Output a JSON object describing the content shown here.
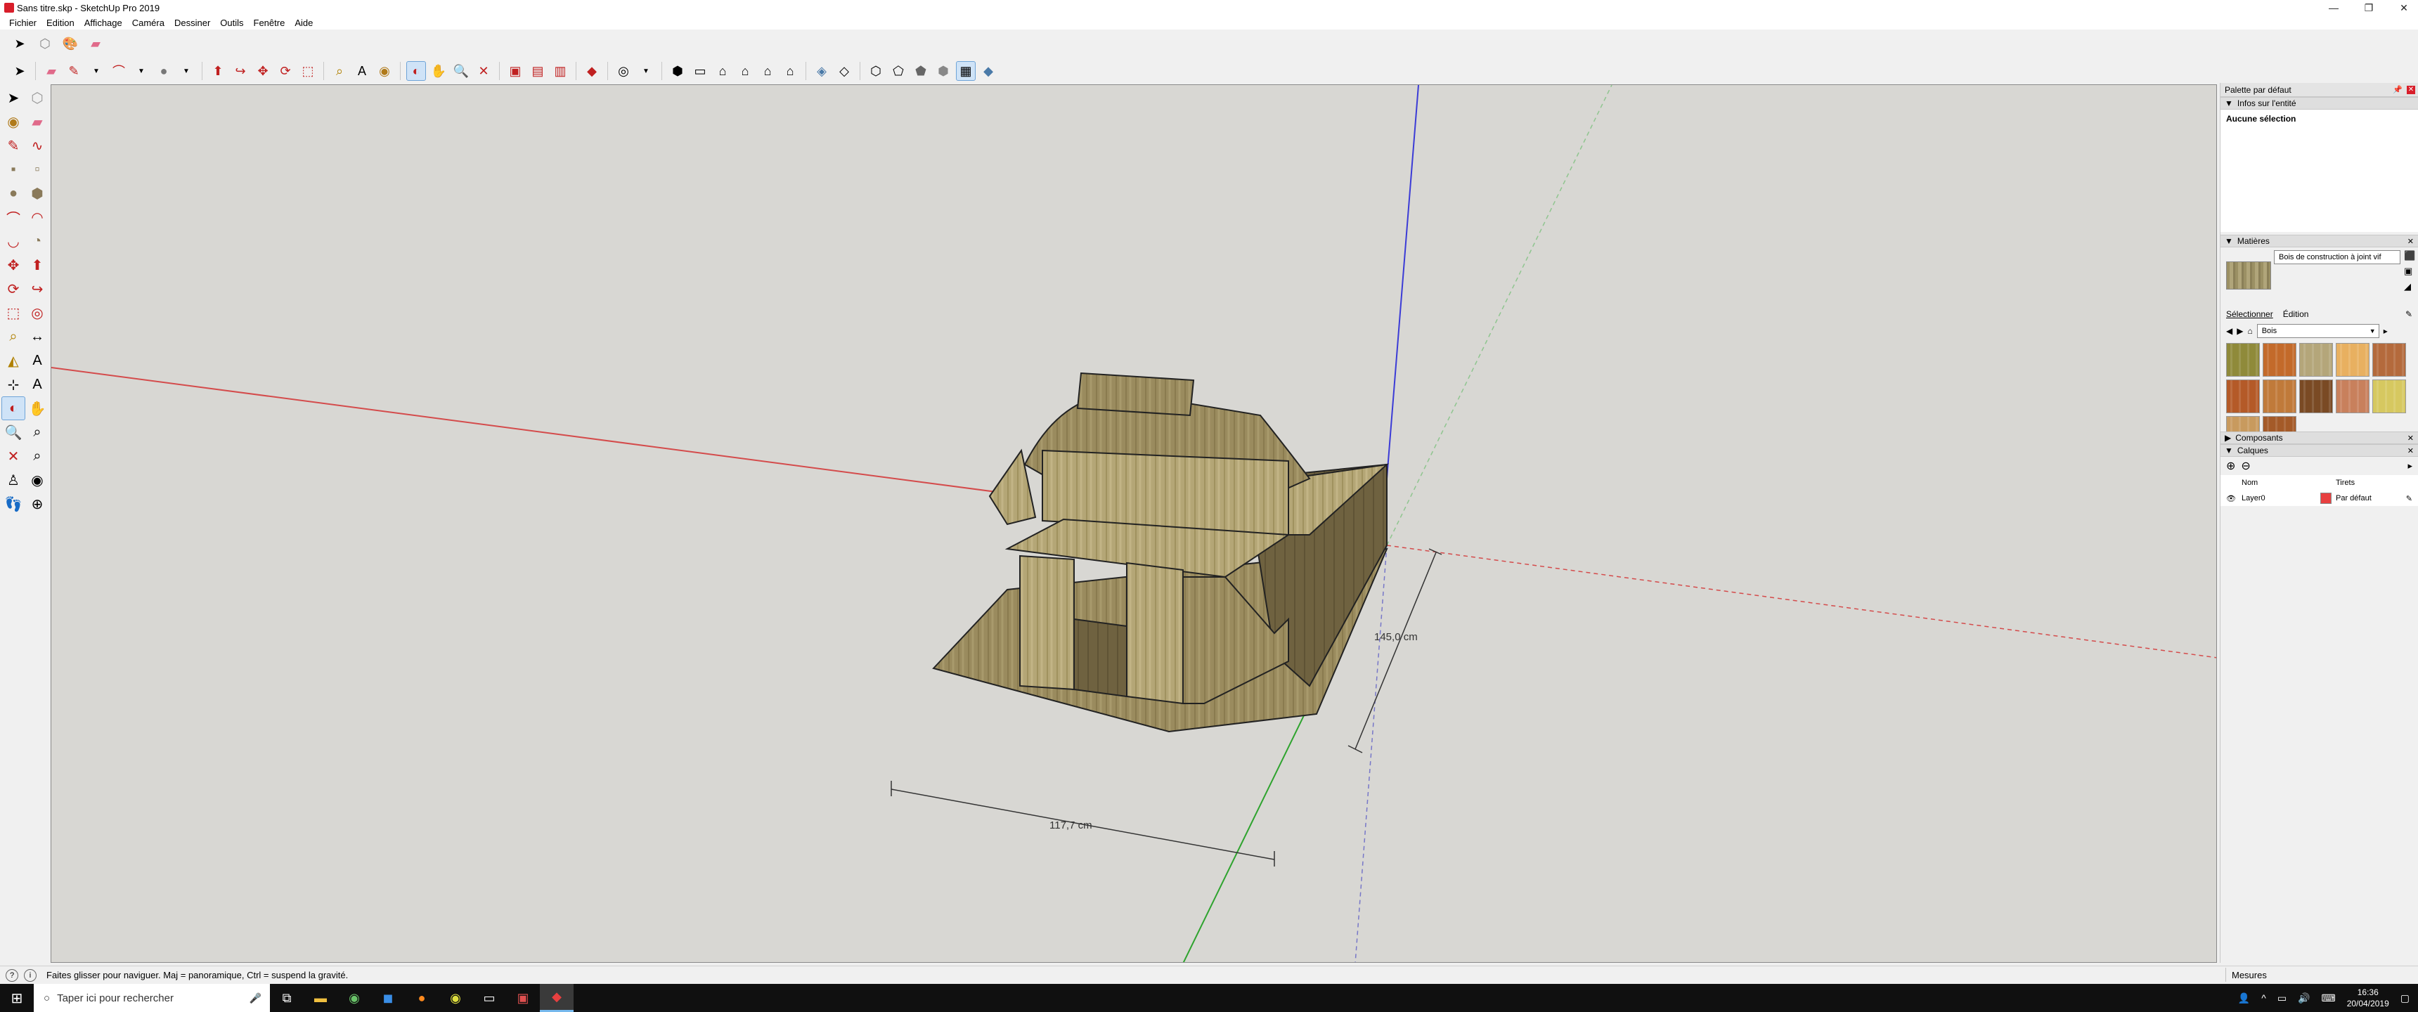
{
  "window": {
    "title": "Sans titre.skp - SketchUp Pro 2019",
    "controls": [
      "—",
      "❐",
      "✕"
    ]
  },
  "menu": [
    "Fichier",
    "Edition",
    "Affichage",
    "Caméra",
    "Dessiner",
    "Outils",
    "Fenêtre",
    "Aide"
  ],
  "viewport": {
    "dimension_width": "117,7 cm",
    "dimension_depth": "145,0 cm",
    "colors": {
      "background": "#d8d7d3",
      "red_axis": "#d44b4b",
      "green_axis": "#2ea32e",
      "blue_axis": "#3b3bd6",
      "wood": "#9a8b5e"
    }
  },
  "status": {
    "hint": "Faites glisser pour naviguer. Maj = panoramique, Ctrl = suspend la gravité.",
    "measures_label": "Mesures"
  },
  "taskbar": {
    "search_placeholder": "Taper ici pour rechercher",
    "time": "16:36",
    "date": "20/04/2019"
  },
  "panel": {
    "title": "Palette par défaut",
    "entity": {
      "header": "Infos sur l'entité",
      "value": "Aucune sélection"
    },
    "materials": {
      "header": "Matières",
      "name": "Bois de construction à joint vif",
      "tab_select": "Sélectionner",
      "tab_edit": "Édition",
      "library": "Bois",
      "swatch_colors": [
        "#8f8a3a",
        "#c36a2a",
        "#b4a67a",
        "#e8b060",
        "#b46a3c",
        "#b45a28",
        "#c07a3a",
        "#7a4a24",
        "#c8805c",
        "#d6c860",
        "#c89a5e",
        "#a45a28"
      ]
    },
    "components": {
      "header": "Composants"
    },
    "layers": {
      "header": "Calques",
      "col_name": "Nom",
      "col_dashes": "Tirets",
      "rows": [
        {
          "name": "Layer0",
          "dashes": "Par défaut"
        }
      ]
    }
  }
}
